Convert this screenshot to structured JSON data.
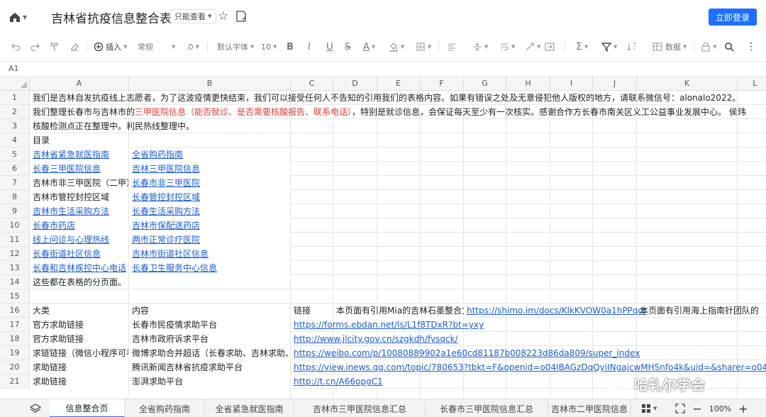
{
  "titlebar": {
    "doc_title": "吉林省抗疫信息整合表",
    "mode": "只能查看",
    "login_label": "立即登录"
  },
  "toolbar": {
    "insert_label": "插入",
    "format_normal": "常规",
    "decimal": ".0",
    "font_default": "默认字体",
    "font_size": "10",
    "bold": "B",
    "italic": "I",
    "underline": "U",
    "strike": "S",
    "text_color": "A",
    "data_label": "数据",
    "sum": "Σ"
  },
  "formula_bar": {
    "cell_ref": "A1"
  },
  "columns": [
    "A",
    "B",
    "C",
    "D",
    "E",
    "F",
    "G",
    "H",
    "I",
    "J",
    "K",
    "L"
  ],
  "rows": [
    "1",
    "2",
    "3",
    "4",
    "5",
    "6",
    "7",
    "8",
    "9",
    "10",
    "11",
    "12",
    "13",
    "14",
    "15",
    "16",
    "17",
    "18",
    "19",
    "20",
    "21"
  ],
  "cells": {
    "r1a": "我们是吉林自发抗疫线上志愿者，为了这波疫情更快结束，我们可以接受任何人不告知的引用我们的表格内容。如果有错误之处及无意侵犯他人版权的地方，请联系微信号：alonalo2022。",
    "r2a_pre": "我们整理长春市与吉林市的",
    "r2a_red": "三甲医院信息（能否就诊、是否需要核酸报告、联系电话）",
    "r2a_post": "，特别是就诊信息，会保证每天至少有一次核实。感谢合作方长春市南关区义工公益事业发展中心。 侯玮",
    "r3a": "核酸检测点正在整理中。利民热线整理中。",
    "r4a": "目录",
    "r5a": "吉林省紧急就医指南",
    "r5b": "全省购药指南",
    "r6a": "长春三甲医院信息",
    "r6b": "吉林三甲医院信息",
    "r7a": "吉林市非三甲医院（二甲）",
    "r7b": "长春市非三甲医院",
    "r8a": "吉林市管控封控区域",
    "r8b": "长春管控封控区域",
    "r9a": "吉林市生活采购方法",
    "r9b": "长春生活采购方法",
    "r10a": "长春市药店",
    "r10b": "吉林市保配送药店",
    "r11a": "线上问诊与心理热线",
    "r11b": "两市正常诊疗医院",
    "r12a": "长春街道社区信息",
    "r12b": "吉林市街道社区信息",
    "r13a": "长春和吉林疾控中心电话",
    "r13b": "长春卫生服务中心信息",
    "r14a": "这些都在表格的分页面。",
    "r16a": "大类",
    "r16b": "内容",
    "r16c": "链接",
    "r16d": "本页面有引用Mia的吉林石墨整合文档",
    "r16g": "https://shimo.im/docs/KlkKVOW0a1hPPqdr",
    "r16k": "本页面有引用海上指南针团队的",
    "r17a": "官方求助链接",
    "r17b": "长春市民疫情求助平台",
    "r17c": "https://forms.ebdan.net/ls/L1f8TDxR?bt=yxy",
    "r18a": "官方求助链接",
    "r18b": "吉林市政府诉求平台",
    "r18c": "http://www.jlcity.gov.cn/szgkdh/fysqck/",
    "r19a": "求链链接（微信小程序可看",
    "r19b": "微博求助合并超话（长春求助、吉林求助、上",
    "r19c": "https://weibo.com/p/10080889902a1e60cd81187b008223d86da809/super_index",
    "r20a": "求助链接",
    "r20b": "腾讯新闻吉林省抗疫求助平台",
    "r20c": "https://view.inews.qq.com/topic/780653?tbkt=F&openid=o04IBAGzDqQyiINgajcwMHSnfo4k&uid=&sharer=o04IBAGCtynkQW-XbjzSM",
    "r21a": "求助链接",
    "r21b": "澎湃求助平台",
    "r21c": "http://t.cn/A66opgC1"
  },
  "sheet_tabs": [
    "信息整合页",
    "全省购药指南",
    "全省紧急就医指南",
    "吉林市三甲医院信息汇总",
    "长春市三甲医院信息汇总",
    "吉林市二甲医院信息"
  ],
  "zoom": "100%",
  "watermark_text": "哈轧尔学会",
  "colors": {
    "accent": "#1e6fff",
    "link": "#1a5cd8",
    "red_text": "#e53935"
  }
}
